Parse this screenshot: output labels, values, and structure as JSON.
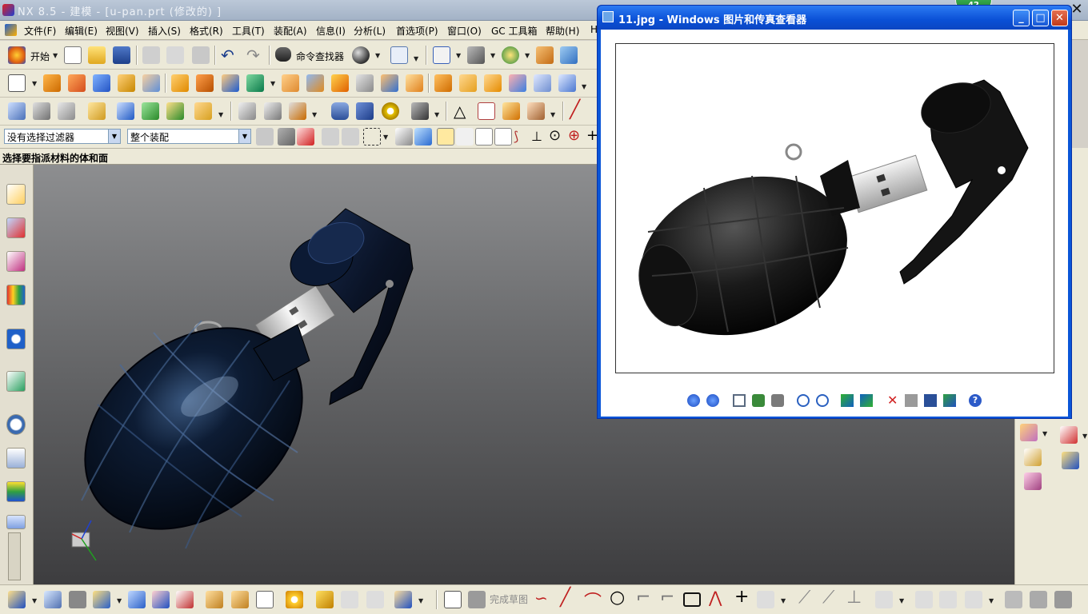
{
  "app": {
    "title": "NX 8.5 - 建模 - [u-pan.prt  (修改的) ]",
    "close_glyph": "✕"
  },
  "menu": {
    "items": [
      "文件(F)",
      "编辑(E)",
      "视图(V)",
      "插入(S)",
      "格式(R)",
      "工具(T)",
      "装配(A)",
      "信息(I)",
      "分析(L)",
      "首选项(P)",
      "窗口(O)",
      "GC 工具箱",
      "帮助(H)",
      "H"
    ]
  },
  "toolbar": {
    "start_label": "开始",
    "finder_label": "命令查找器"
  },
  "selection": {
    "filter_value": "没有选择过滤器",
    "scope_value": "整个装配"
  },
  "cue": {
    "text": "选择要指派材料的体和面"
  },
  "bottom": {
    "finish_sketch_label": "完成草图"
  },
  "viewer": {
    "title": "11.jpg - Windows 图片和传真查看器",
    "minimize_glyph": "_",
    "maximize_glyph": "□",
    "close_glyph": "✕"
  },
  "badge": {
    "count": "42"
  },
  "icons": [
    "nx-logo-icon",
    "new-icon",
    "open-icon",
    "save-icon",
    "cut-icon",
    "copy-icon",
    "paste-icon",
    "undo-icon",
    "redo-icon",
    "binoculars-icon",
    "sphere-icon",
    "info-icon",
    "zoom-fit-icon",
    "view-icon",
    "shade-icon",
    "sketch-icon",
    "extrude-icon",
    "revolve-icon",
    "block-icon",
    "cylinder-icon",
    "cone-icon",
    "sphere-feature-icon",
    "hole-icon",
    "boss-icon",
    "pocket-icon",
    "pad-icon",
    "slot-icon",
    "groove-icon",
    "blend-icon",
    "chamfer-icon",
    "shell-icon",
    "trim-icon",
    "unite-icon",
    "subtract-icon",
    "intersect-icon",
    "datum-icon",
    "point-icon",
    "line-icon",
    "circle-icon",
    "rectangle-icon",
    "arc-icon",
    "help-icon"
  ]
}
